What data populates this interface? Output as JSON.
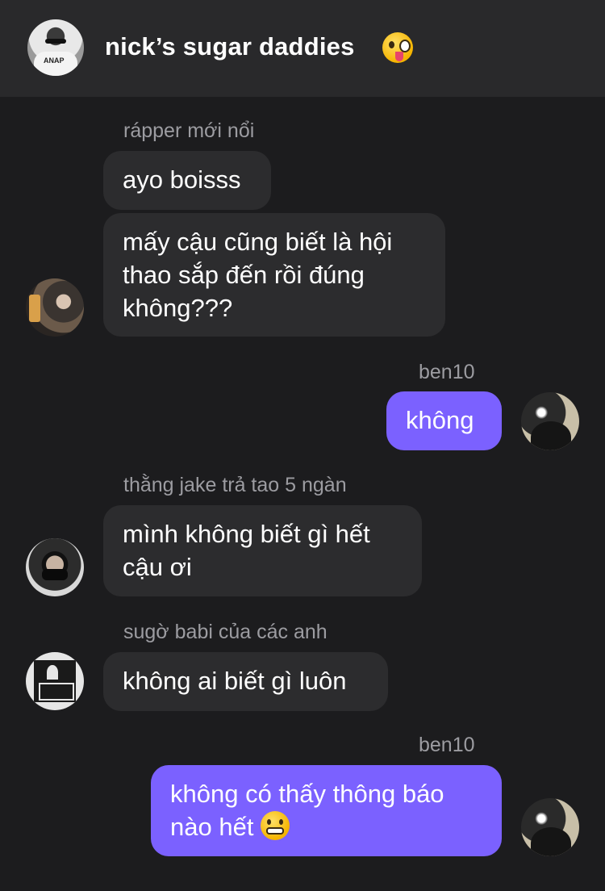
{
  "header": {
    "title": "nick’s sugar daddies",
    "title_emoji": "zany-face-emoji",
    "avatar_shirt_text": "ANAP"
  },
  "colors": {
    "background": "#1c1c1e",
    "header_bg": "#29292b",
    "bubble_other": "#2c2c2e",
    "bubble_me": "#7b61ff",
    "sender_text": "#9c9ca1"
  },
  "messages": [
    {
      "sender": "rápper mới nổi",
      "from_me": false,
      "bubbles": [
        {
          "lines": [
            "ayo boisss"
          ]
        },
        {
          "lines": [
            "mấy cậu cũng biết là hội",
            "thao sắp đến rồi đúng",
            "không???"
          ]
        }
      ]
    },
    {
      "sender": "ben10",
      "from_me": true,
      "bubbles": [
        {
          "lines": [
            "không"
          ]
        }
      ]
    },
    {
      "sender": "thằng jake trả tao 5 ngàn",
      "from_me": false,
      "bubbles": [
        {
          "lines": [
            "mình không biết gì hết",
            "cậu ơi"
          ]
        }
      ]
    },
    {
      "sender": "sugờ babi của các anh",
      "from_me": false,
      "bubbles": [
        {
          "lines": [
            "không ai biết gì luôn"
          ]
        }
      ]
    },
    {
      "sender": "ben10",
      "from_me": true,
      "bubbles": [
        {
          "lines": [
            "không có thấy thông báo",
            "nào hết"
          ],
          "trailing_emoji": "grimacing-face-emoji"
        }
      ]
    }
  ]
}
